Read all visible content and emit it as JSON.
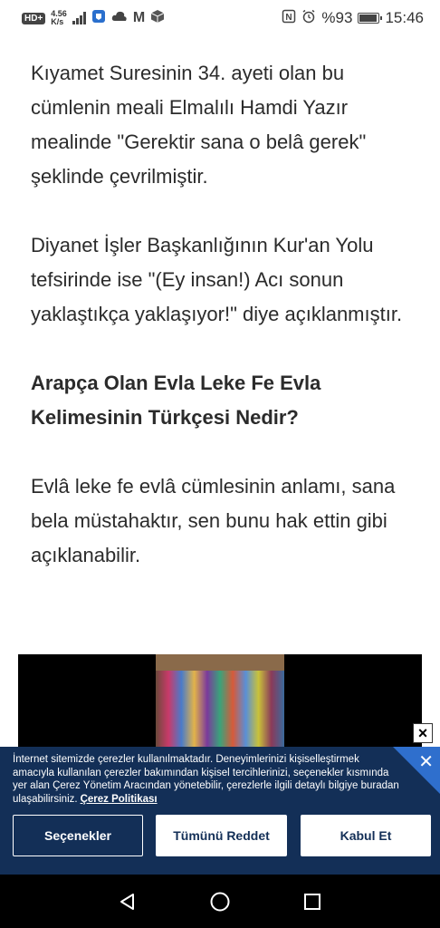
{
  "status_bar": {
    "hd": "HD+",
    "net_top": "4.56",
    "net_bottom": "K/s",
    "nfc": "N",
    "alarm": "⏰",
    "battery": "%93",
    "battery_level": 0.93,
    "time": "15:46"
  },
  "article": {
    "para1": "Kıyamet Suresinin 34. ayeti olan bu cümlenin meali Elmalılı Hamdi Yazır mealinde \"Gerektir sana o belâ gerek\" şeklinde çevrilmiştir.",
    "para2": "Diyanet İşler Başkanlığının Kur'an Yolu tefsirinde ise \"(Ey insan!) Acı sonun yaklaştıkça yaklaşıyor!\" diye açıklanmıştır.",
    "heading": "Arapça Olan Evla Leke Fe Evla Kelimesinin Türkçesi Nedir?",
    "para3": "Evlâ leke fe evlâ cümlesinin anlamı, sana bela müstahaktır, sen bunu hak ettin gibi açıklanabilir."
  },
  "video": {
    "close": "×"
  },
  "cookie": {
    "text": "İnternet sitemizde çerezler kullanılmaktadır. Deneyimlerinizi kişiselleştirmek amacıyla kullanılan çerezler bakımından kişisel tercihlerinizi, seçenekler kısmında yer alan Çerez Yönetim Aracından yönetebilir, çerezlerle ilgili detaylı bilgiye buradan ulaşabilirsiniz.",
    "policy_link": "Çerez Politikası",
    "close": "✕",
    "options_label": "Seçenekler",
    "reject_label": "Tümünü Reddet",
    "accept_label": "Kabul Et"
  },
  "colors": {
    "banner_bg": "#132f57",
    "banner_accent": "#2f6fcd"
  }
}
